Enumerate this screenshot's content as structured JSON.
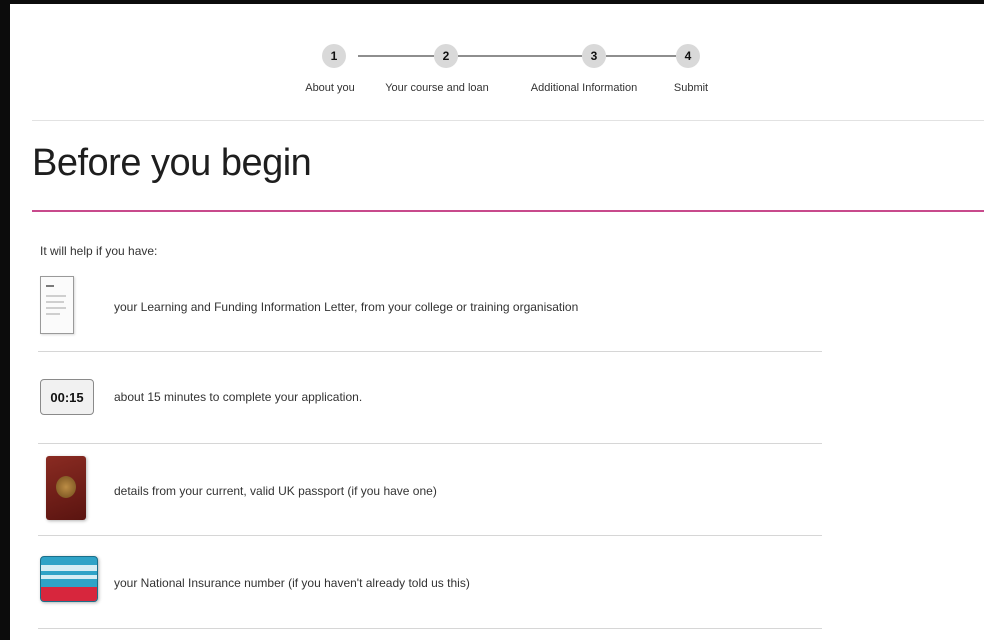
{
  "stepper": {
    "steps": [
      {
        "number": "1",
        "label": "About you"
      },
      {
        "number": "2",
        "label": "Your course and loan"
      },
      {
        "number": "3",
        "label": "Additional Information"
      },
      {
        "number": "4",
        "label": "Submit"
      }
    ]
  },
  "page": {
    "title": "Before you begin",
    "intro": "It will help if you have:"
  },
  "items": [
    {
      "icon": "letter-icon",
      "text": "your Learning and Funding Information Letter, from your college or training organisation"
    },
    {
      "icon": "timer-icon",
      "timer": "00:15",
      "text": "about 15 minutes to complete your application."
    },
    {
      "icon": "passport-icon",
      "text": "details from your current, valid UK passport (if you have one)"
    },
    {
      "icon": "national-insurance-card-icon",
      "text": "your National Insurance number (if you haven't already told us this)"
    }
  ],
  "colors": {
    "accent": "#c84a8c",
    "step_circle": "#d9d9d9",
    "background": "#ffffff"
  }
}
